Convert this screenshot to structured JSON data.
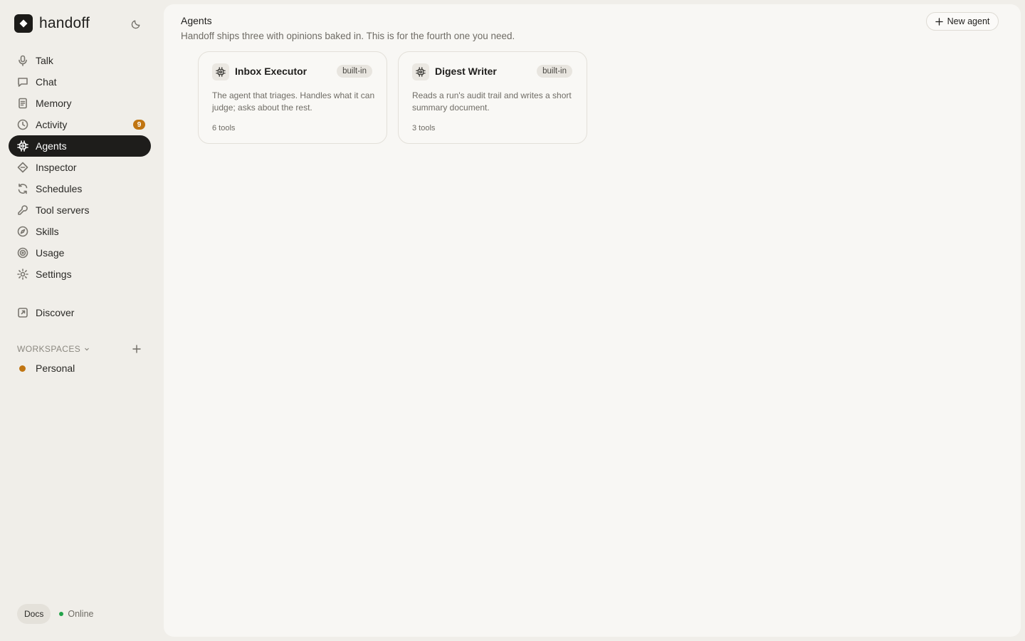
{
  "app": {
    "name": "handoff"
  },
  "sidebar": {
    "items": [
      {
        "label": "Talk",
        "icon": "microphone-icon"
      },
      {
        "label": "Chat",
        "icon": "chat-bubble-icon"
      },
      {
        "label": "Memory",
        "icon": "document-icon"
      },
      {
        "label": "Activity",
        "icon": "clock-icon",
        "badge": "9"
      },
      {
        "label": "Agents",
        "icon": "agent-chip-icon",
        "active": true
      },
      {
        "label": "Inspector",
        "icon": "diamond-icon"
      },
      {
        "label": "Schedules",
        "icon": "refresh-icon"
      },
      {
        "label": "Tool servers",
        "icon": "wrench-icon"
      },
      {
        "label": "Skills",
        "icon": "compass-icon"
      },
      {
        "label": "Usage",
        "icon": "target-icon"
      },
      {
        "label": "Settings",
        "icon": "sun-gear-icon"
      }
    ],
    "discover": {
      "label": "Discover",
      "icon": "external-link-icon"
    },
    "workspaces": {
      "header": "WORKSPACES",
      "items": [
        {
          "label": "Personal",
          "color": "#c07512"
        }
      ]
    },
    "footer": {
      "docs_label": "Docs",
      "status_label": "Online",
      "status_color": "#22a34a"
    }
  },
  "main": {
    "title": "Agents",
    "subtitle": "Handoff ships three with opinions baked in. This is for the fourth one you need.",
    "new_button_label": "New agent",
    "cards": [
      {
        "name": "Inbox Executor",
        "badge": "built-in",
        "description": "The agent that triages. Handles what it can judge; asks about the rest.",
        "tools": "6 tools"
      },
      {
        "name": "Digest Writer",
        "badge": "built-in",
        "description": "Reads a run's audit trail and writes a short summary document.",
        "tools": "3 tools"
      }
    ]
  }
}
